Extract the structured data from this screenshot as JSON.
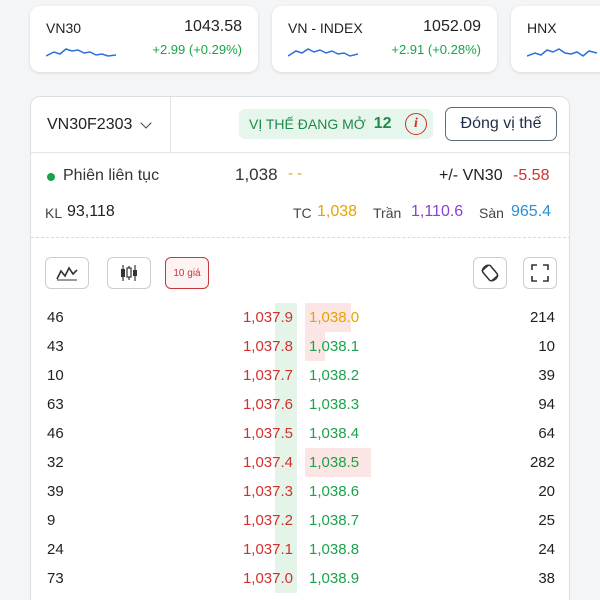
{
  "indices": [
    {
      "name": "VN30",
      "value": "1043.58",
      "change": "+2.99 (+0.29%)"
    },
    {
      "name": "VN - INDEX",
      "value": "1052.09",
      "change": "+2.91 (+0.28%)"
    },
    {
      "name": "HNX",
      "value": "",
      "change": ""
    }
  ],
  "contract": {
    "symbol": "VN30F2303"
  },
  "position": {
    "label": "VỊ THẾ ĐANG MỞ",
    "count": "12",
    "info_icon": "i"
  },
  "close_button": "Đóng vị thế",
  "session": {
    "label": "Phiên liên tục",
    "price": "1,038",
    "change": "- -",
    "diff_label": "+/- VN30",
    "diff_value": "-5.58"
  },
  "stats": {
    "kl_label": "KL",
    "kl_value": "93,118",
    "tc_label": "TC",
    "tc_value": "1,038",
    "tran_label": "Trần",
    "tran_value": "1,110.6",
    "san_label": "Sàn",
    "san_value": "965.4"
  },
  "toolbar": {
    "depth_label": "10 giá"
  },
  "colors": {
    "up": "#1aa34a",
    "down": "#d0312d",
    "ref": "#e5a400",
    "ceiling": "#8b3fd9",
    "floor": "#2a8fd6"
  },
  "orderbook": [
    {
      "bid_qty": "46",
      "bid_price": "1,037.9",
      "ask_price": "1,038.0",
      "ask_qty": "214"
    },
    {
      "bid_qty": "43",
      "bid_price": "1,037.8",
      "ask_price": "1,038.1",
      "ask_qty": "10"
    },
    {
      "bid_qty": "10",
      "bid_price": "1,037.7",
      "ask_price": "1,038.2",
      "ask_qty": "39"
    },
    {
      "bid_qty": "63",
      "bid_price": "1,037.6",
      "ask_price": "1,038.3",
      "ask_qty": "94"
    },
    {
      "bid_qty": "46",
      "bid_price": "1,037.5",
      "ask_price": "1,038.4",
      "ask_qty": "64"
    },
    {
      "bid_qty": "32",
      "bid_price": "1,037.4",
      "ask_price": "1,038.5",
      "ask_qty": "282"
    },
    {
      "bid_qty": "39",
      "bid_price": "1,037.3",
      "ask_price": "1,038.6",
      "ask_qty": "20"
    },
    {
      "bid_qty": "9",
      "bid_price": "1,037.2",
      "ask_price": "1,038.7",
      "ask_qty": "25"
    },
    {
      "bid_qty": "24",
      "bid_price": "1,037.1",
      "ask_price": "1,038.8",
      "ask_qty": "24"
    },
    {
      "bid_qty": "73",
      "bid_price": "1,037.0",
      "ask_price": "1,038.9",
      "ask_qty": "38"
    }
  ]
}
